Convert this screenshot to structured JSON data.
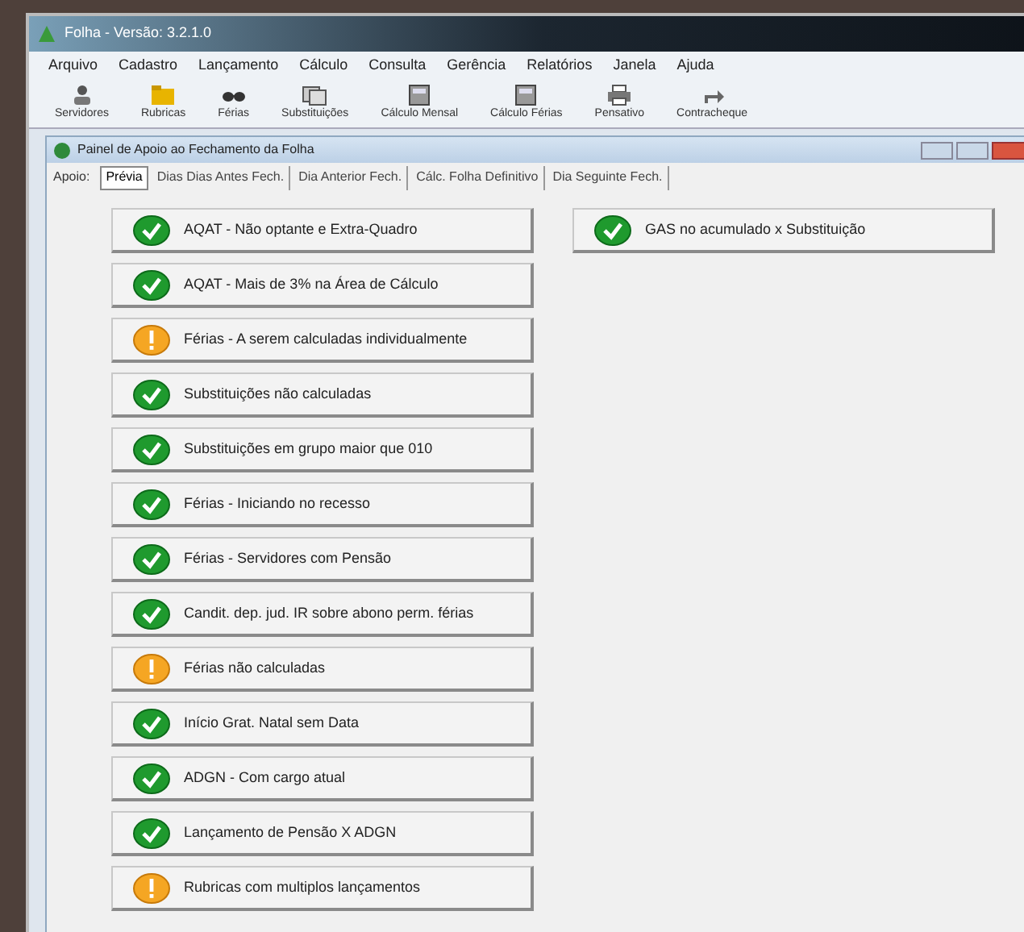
{
  "window": {
    "title": "Folha - Versão: 3.2.1.0"
  },
  "menu": [
    "Arquivo",
    "Cadastro",
    "Lançamento",
    "Cálculo",
    "Consulta",
    "Gerência",
    "Relatórios",
    "Janela",
    "Ajuda"
  ],
  "toolbar": [
    {
      "label": "Servidores",
      "kind": "person"
    },
    {
      "label": "Rubricas",
      "kind": "folder"
    },
    {
      "label": "Férias",
      "kind": "glasses"
    },
    {
      "label": "Substituições",
      "kind": "cards"
    },
    {
      "label": "Cálculo Mensal",
      "kind": "calc"
    },
    {
      "label": "Cálculo Férias",
      "kind": "calc"
    },
    {
      "label": "Pensativo",
      "kind": "printer"
    },
    {
      "label": "Contracheque",
      "kind": "arrow"
    }
  ],
  "panel": {
    "title": "Painel de Apoio ao Fechamento da Folha",
    "tabs_label": "Apoio:",
    "tabs": [
      {
        "label": "Prévia",
        "selected": true
      },
      {
        "label": "Dias Dias Antes Fech.",
        "selected": false
      },
      {
        "label": "Dia Anterior Fech.",
        "selected": false
      },
      {
        "label": "Cálc. Folha Definitivo",
        "selected": false
      },
      {
        "label": "Dia Seguinte Fech.",
        "selected": false
      }
    ],
    "column_1": [
      {
        "label": "AQAT - Não optante e Extra-Quadro",
        "kind": "ok"
      },
      {
        "label": "AQAT - Mais de 3% na Área de Cálculo",
        "kind": "ok"
      },
      {
        "label": "Férias - A serem calculadas individualmente",
        "kind": "warning"
      },
      {
        "label": "Substituições não calculadas",
        "kind": "ok"
      },
      {
        "label": "Substituições em grupo maior que 010",
        "kind": "ok"
      },
      {
        "label": "Férias - Iniciando no recesso",
        "kind": "ok"
      },
      {
        "label": "Férias - Servidores com Pensão",
        "kind": "ok"
      },
      {
        "label": "Candit. dep. jud. IR sobre abono perm. férias",
        "kind": "ok"
      },
      {
        "label": "Férias não calculadas",
        "kind": "warning"
      },
      {
        "label": "Início Grat. Natal sem Data",
        "kind": "ok"
      },
      {
        "label": "ADGN - Com cargo atual",
        "kind": "ok"
      },
      {
        "label": "Lançamento de Pensão X ADGN",
        "kind": "ok"
      },
      {
        "label": "Rubricas com multiplos lançamentos",
        "kind": "warning"
      }
    ],
    "column_2": [
      {
        "label": "GAS no acumulado x Substituição",
        "kind": "ok"
      }
    ]
  }
}
